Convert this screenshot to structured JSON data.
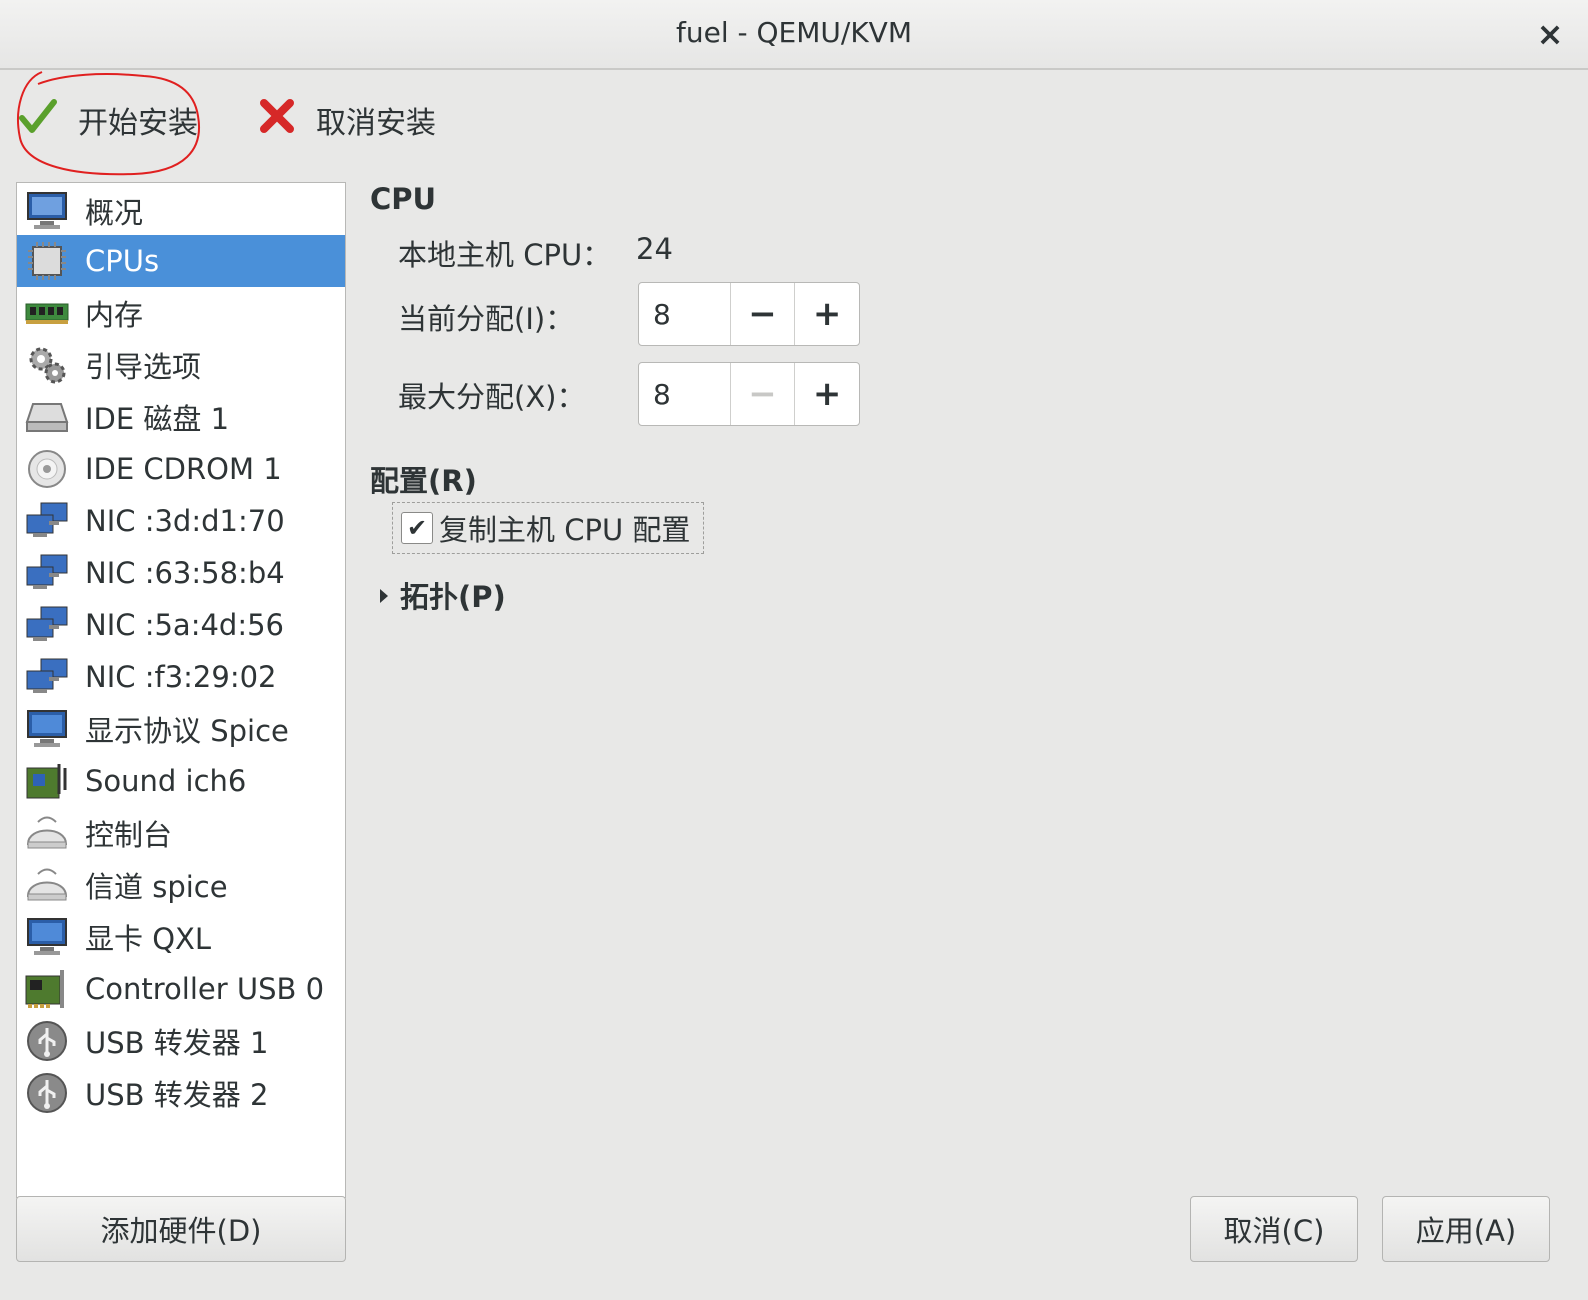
{
  "window": {
    "title": "fuel - QEMU/KVM",
    "close_glyph": "×"
  },
  "toolbar": {
    "start_install": {
      "label": "开始安装",
      "icon": "check-icon"
    },
    "cancel_install": {
      "label": "取消安装",
      "icon": "cross-icon"
    }
  },
  "sidebar": {
    "items": [
      {
        "label": "概况",
        "icon": "monitor-icon",
        "selected": false
      },
      {
        "label": "CPUs",
        "icon": "cpu-chip-icon",
        "selected": true
      },
      {
        "label": "内存",
        "icon": "memory-icon",
        "selected": false
      },
      {
        "label": "引导选项",
        "icon": "gears-icon",
        "selected": false
      },
      {
        "label": "IDE 磁盘 1",
        "icon": "disk-icon",
        "selected": false
      },
      {
        "label": "IDE CDROM 1",
        "icon": "cdrom-icon",
        "selected": false
      },
      {
        "label": "NIC :3d:d1:70",
        "icon": "network-icon",
        "selected": false
      },
      {
        "label": "NIC :63:58:b4",
        "icon": "network-icon",
        "selected": false
      },
      {
        "label": "NIC :5a:4d:56",
        "icon": "network-icon",
        "selected": false
      },
      {
        "label": "NIC :f3:29:02",
        "icon": "network-icon",
        "selected": false
      },
      {
        "label": "显示协议 Spice",
        "icon": "display-icon",
        "selected": false
      },
      {
        "label": "Sound ich6",
        "icon": "sound-icon",
        "selected": false
      },
      {
        "label": "控制台",
        "icon": "serial-icon",
        "selected": false
      },
      {
        "label": "信道 spice",
        "icon": "serial-icon",
        "selected": false
      },
      {
        "label": "显卡 QXL",
        "icon": "display-icon",
        "selected": false
      },
      {
        "label": "Controller USB 0",
        "icon": "pci-card-icon",
        "selected": false
      },
      {
        "label": "USB 转发器 1",
        "icon": "usb-icon",
        "selected": false
      },
      {
        "label": "USB 转发器 2",
        "icon": "usb-icon",
        "selected": false
      }
    ],
    "add_hardware": "添加硬件(D)"
  },
  "main": {
    "cpu_section": "CPU",
    "host_cpu_label": "本地主机 CPU：",
    "host_cpu_value": "24",
    "current_alloc_label": "当前分配(I)：",
    "current_alloc_value": "8",
    "max_alloc_label": "最大分配(X)：",
    "max_alloc_value": "8",
    "config_section": "配置(R)",
    "copy_host_cpu_label": "复制主机 CPU 配置",
    "copy_host_cpu_checked": true,
    "topology_label": "拓扑(P)"
  },
  "footer": {
    "cancel": "取消(C)",
    "apply": "应用(A)"
  },
  "colors": {
    "selection": "#4a90d9",
    "annotation": "#e02020"
  }
}
